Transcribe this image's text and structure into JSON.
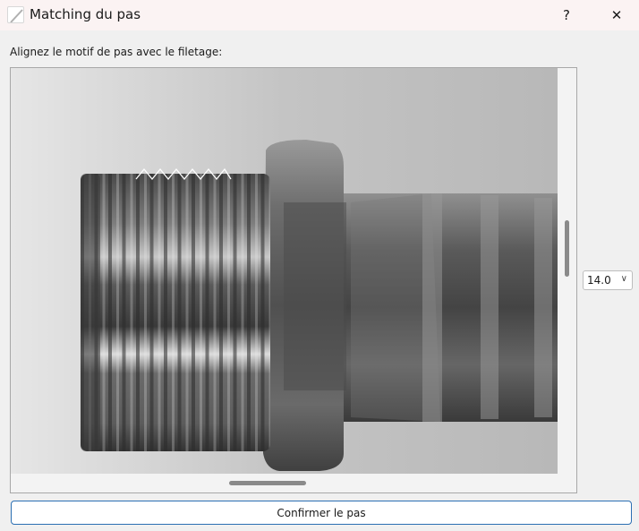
{
  "window": {
    "title": "Matching du pas",
    "help_label": "?",
    "close_label": "✕",
    "icon": "pencil-icon"
  },
  "prompt": "Alignez le motif de pas avec le filetage:",
  "pitch_select": {
    "value": "14.0",
    "chevron": "∨"
  },
  "confirm_button": "Confirmer le pas",
  "colors": {
    "accent": "#2b6fb3",
    "titlebar": "#fbf3f3",
    "background": "#f0f0f0"
  }
}
